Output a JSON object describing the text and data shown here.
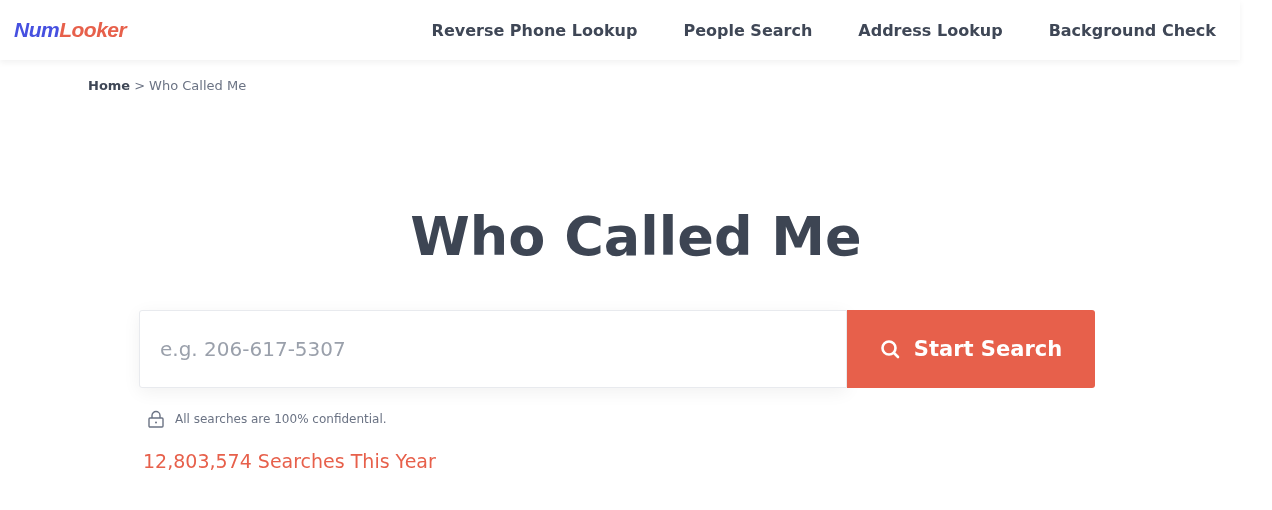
{
  "logo": {
    "part_1": "Num",
    "part_2": "Looker"
  },
  "nav": [
    {
      "label": "Reverse Phone Lookup"
    },
    {
      "label": "People Search"
    },
    {
      "label": "Address Lookup"
    },
    {
      "label": "Background Check"
    }
  ],
  "breadcrumb": {
    "home": "Home",
    "separator": ">",
    "current": "Who Called Me"
  },
  "title": "Who Called Me",
  "search": {
    "placeholder": "e.g. 206-617-5307",
    "button": "Start Search"
  },
  "note": "All searches are 100% confidential.",
  "counter": "12,803,574 Searches This Year"
}
